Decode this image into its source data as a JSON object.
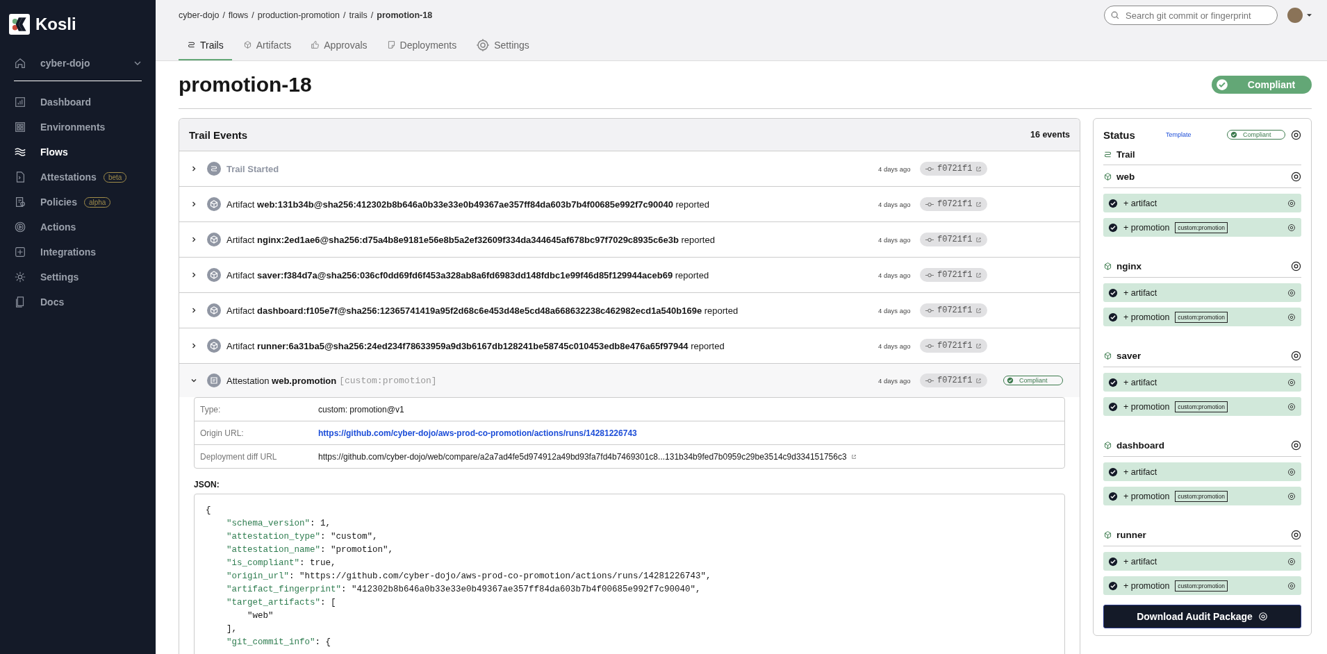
{
  "logo": {
    "text": "Kosli"
  },
  "org": {
    "name": "cyber-dojo"
  },
  "sidebar": {
    "items": [
      {
        "label": "Dashboard",
        "selected": false
      },
      {
        "label": "Environments",
        "selected": false
      },
      {
        "label": "Flows",
        "selected": true
      },
      {
        "label": "Attestations",
        "selected": false,
        "badge": "beta"
      },
      {
        "label": "Policies",
        "selected": false,
        "badge": "alpha"
      },
      {
        "label": "Actions",
        "selected": false
      },
      {
        "label": "Integrations",
        "selected": false
      },
      {
        "label": "Settings",
        "selected": false
      },
      {
        "label": "Docs",
        "selected": false
      }
    ]
  },
  "breadcrumb": {
    "separator": "/",
    "items": [
      "cyber-dojo",
      "flows",
      "production-promotion",
      "trails",
      "promotion-18"
    ]
  },
  "search": {
    "placeholder": "Search git commit or fingerprint"
  },
  "tabs": [
    {
      "label": "Trails",
      "selected": true
    },
    {
      "label": "Artifacts",
      "selected": false
    },
    {
      "label": "Approvals",
      "selected": false
    },
    {
      "label": "Deployments",
      "selected": false
    },
    {
      "label": "Settings",
      "selected": false
    }
  ],
  "title": "promotion-18",
  "compliance": {
    "label": "Compliant",
    "compliant": true
  },
  "trail_events": {
    "title": "Trail Events",
    "count": "16 events",
    "events": [
      {
        "kind": "trail",
        "text": "Trail Started",
        "time": "4 days ago",
        "commit": "f0721f1",
        "expanded": false
      },
      {
        "kind": "artifact",
        "text": "Artifact **web:131b34b@sha256:412302b8b646a0b33e33e0b49367ae357ff84da603b7b4f00685e992f7c90040** reported",
        "time": "4 days ago",
        "commit": "f0721f1",
        "expanded": false
      },
      {
        "kind": "artifact",
        "text": "Artifact **nginx:2ed1ae6@sha256:d75a4b8e9181e56e8b5a2ef32609f334da344645af678bc97f7029c8935c6e3b** reported",
        "time": "4 days ago",
        "commit": "f0721f1",
        "expanded": false
      },
      {
        "kind": "artifact",
        "text": "Artifact **saver:f384d7a@sha256:036cf0dd69fd6f453a328ab8a6fd6983dd148fdbc1e99f46d85f129944aceb69** reported",
        "time": "4 days ago",
        "commit": "f0721f1",
        "expanded": false
      },
      {
        "kind": "artifact",
        "text": "Artifact **dashboard:f105e7f@sha256:12365741419a95f2d68c6e453d48e5cd48a668632238c462982ecd1a540b169e** reported",
        "time": "4 days ago",
        "commit": "f0721f1",
        "expanded": false
      },
      {
        "kind": "artifact",
        "text": "Artifact **runner:6a31ba5@sha256:24ed234f78633959a9d3b6167db128241be58745c010453edb8e476a65f97944** reported",
        "time": "4 days ago",
        "commit": "f0721f1",
        "expanded": false
      },
      {
        "kind": "attestation",
        "text": "Attestation **web.promotion**",
        "type_tag": "[custom:promotion]",
        "time": "4 days ago",
        "commit": "f0721f1",
        "expanded": true,
        "status": "Compliant",
        "compliant": true
      }
    ]
  },
  "details": [
    {
      "label": "Type:",
      "value": "custom: promotion@v1",
      "kind": "text"
    },
    {
      "label": "Origin URL:",
      "value": "https://github.com/cyber-dojo/aws-prod-co-promotion/actions/runs/14281226743",
      "kind": "link"
    },
    {
      "label": "Deployment diff URL",
      "value": "https://github.com/cyber-dojo/web/compare/a2a7ad4fe5d974912a49bd93fa7fd4b7469301c8...131b34b9fed7b0959c29be3514c9d334151756c3",
      "kind": "external"
    }
  ],
  "json": {
    "label": "JSON:",
    "lines": [
      {
        "text": "{",
        "children": [
          {
            "key": "\"schema_version\"",
            "rest": ": 1,"
          },
          {
            "key": "\"attestation_type\"",
            "rest": ": \"custom\","
          },
          {
            "key": "\"attestation_name\"",
            "rest": ": \"promotion\","
          },
          {
            "key": "\"is_compliant\"",
            "rest": ": true,"
          },
          {
            "key": "\"origin_url\"",
            "rest": ": \"https://github.com/cyber-dojo/aws-prod-co-promotion/actions/runs/14281226743\","
          },
          {
            "key": "\"artifact_fingerprint\"",
            "rest": ": \"412302b8b646a0b33e33e0b49367ae357ff84da603b7b4f00685e992f7c90040\","
          },
          {
            "key": "\"target_artifacts\"",
            "rest": ": [",
            "children": [
              {
                "text": "\"web\""
              }
            ]
          },
          {
            "text": "],"
          },
          {
            "key": "\"git_commit_info\"",
            "rest": ": {"
          }
        ]
      }
    ]
  },
  "status": {
    "title": "Status",
    "template": "Template",
    "badge": "Compliant",
    "compliant": true,
    "trail": "Trail",
    "groups": [
      {
        "name": "web",
        "items": [
          {
            "label": "+ artifact",
            "ok": true
          },
          {
            "label": "+ promotion",
            "tag": "custom:promotion",
            "ok": true
          }
        ]
      },
      {
        "name": "nginx",
        "items": [
          {
            "label": "+ artifact",
            "ok": true
          },
          {
            "label": "+ promotion",
            "tag": "custom:promotion",
            "ok": true
          }
        ]
      },
      {
        "name": "saver",
        "items": [
          {
            "label": "+ artifact",
            "ok": true
          },
          {
            "label": "+ promotion",
            "tag": "custom:promotion",
            "ok": true
          }
        ]
      },
      {
        "name": "dashboard",
        "items": [
          {
            "label": "+ artifact",
            "ok": true
          },
          {
            "label": "+ promotion",
            "tag": "custom:promotion",
            "ok": true
          }
        ]
      },
      {
        "name": "runner",
        "items": [
          {
            "label": "+ artifact",
            "ok": true
          },
          {
            "label": "+ promotion",
            "tag": "custom:promotion",
            "ok": true
          }
        ]
      }
    ],
    "download": "Download Audit Package"
  }
}
